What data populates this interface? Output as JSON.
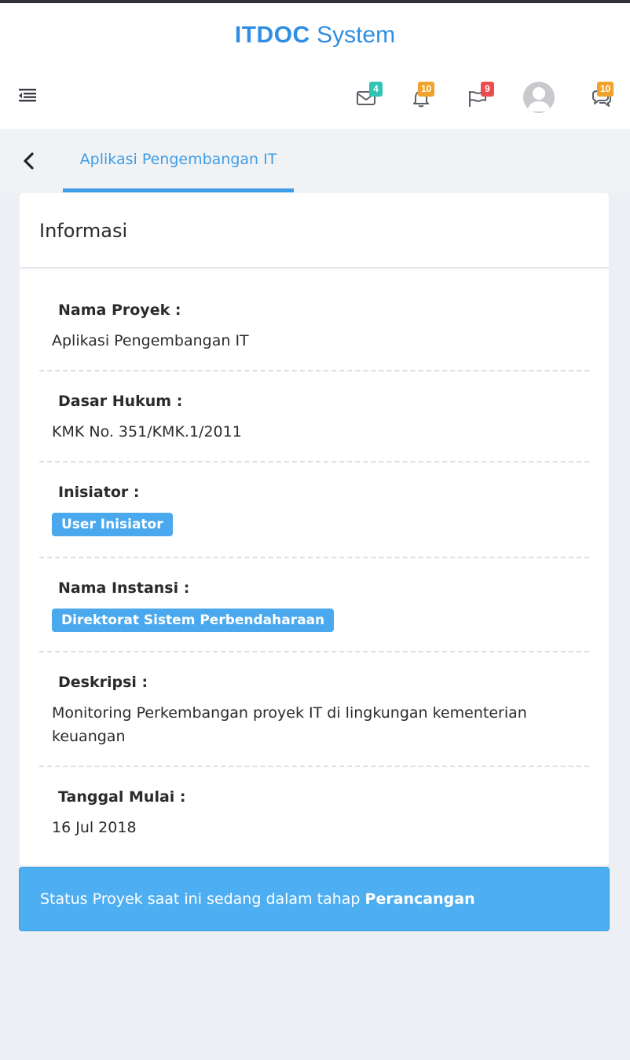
{
  "header": {
    "brand_bold": "ITDOC",
    "brand_light": "System",
    "badges": {
      "mail": "4",
      "bell": "10",
      "flag": "9",
      "chat": "10"
    },
    "colors": {
      "mail_badge": "#2fc4b4",
      "bell_badge": "#f0a22a",
      "flag_badge": "#ec4c4c",
      "chat_badge": "#f0a22a"
    }
  },
  "subnav": {
    "tab_label": "Aplikasi Pengembangan IT"
  },
  "card": {
    "title": "Informasi",
    "fields": [
      {
        "label": "Nama Proyek :",
        "value": "Aplikasi Pengembangan IT"
      },
      {
        "label": "Dasar Hukum :",
        "value": "KMK No. 351/KMK.1/2011"
      },
      {
        "label": "Inisiator :",
        "value": "User Inisiator"
      },
      {
        "label": "Nama Instansi :",
        "value": "Direktorat Sistem Perbendaharaan"
      },
      {
        "label": "Deskripsi :",
        "value": "Monitoring Perkembangan proyek IT di lingkungan kementerian keuangan"
      },
      {
        "label": "Tanggal Mulai :",
        "value": "16 Jul 2018"
      }
    ]
  },
  "status": {
    "prefix": "Status Proyek saat ini sedang dalam tahap ",
    "stage": "Perancangan"
  },
  "icons": [
    "menu-icon",
    "envelope-icon",
    "bell-icon",
    "flag-icon",
    "avatar",
    "chat-icon",
    "chevron-left-icon"
  ]
}
